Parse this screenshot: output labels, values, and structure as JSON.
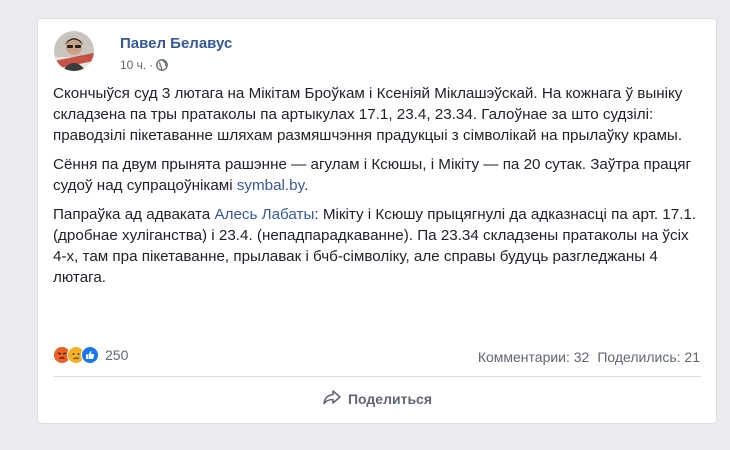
{
  "post": {
    "author": "Павел Белавус",
    "time": "10 ч.",
    "separator": "·",
    "privacy_icon": "globe-icon",
    "paragraphs": {
      "p1": "Скончыўся суд 3 лютага на Мікітам Броўкам і Ксеніяй Міклашэўскай. На кожнага ў выніку складзена па тры пратаколы па артыкулах 17.1, 23.4, 23.34. Галоўнае за што судзілі: праводзілі пікетаванне шляхам размяшчэння прадукцыі з сімволікай на прылаўку крамы.",
      "p2_text": "Сёння па двум прынята рашэнне — агулам і Ксюшы, і Мікіту — па 20 сутак. Заўтра працяг судоў над супрацоўнікамі ",
      "p2_link": "symbal.by",
      "p2_end": ".",
      "p3_start": "Папраўка ад адваката ",
      "p3_link": "Алесь Лабаты",
      "p3_text": ": Мікіту і Ксюшу прыцягнулі да адказнасці па арт. 17.1. (дробнае хуліганства) і 23.4. (непадпарадкаванне). Па 23.34 складзены пратаколы на ўсіх 4-х, там пра пікетаванне, прылавак і бчб-сімволіку, але справы будуць разгледжаны 4 лютага."
    }
  },
  "reactions": {
    "icons": [
      "angry-icon",
      "sad-icon",
      "like-icon"
    ],
    "count": "250"
  },
  "stats": {
    "comments": "Комментарии: 32",
    "shares": "Поделились: 21"
  },
  "actions": {
    "share_label": "Поделиться",
    "share_icon": "share-arrow-icon"
  },
  "colors": {
    "link": "#385898",
    "text": "#1d2129",
    "muted": "#606770",
    "background": "#e9ebee"
  }
}
